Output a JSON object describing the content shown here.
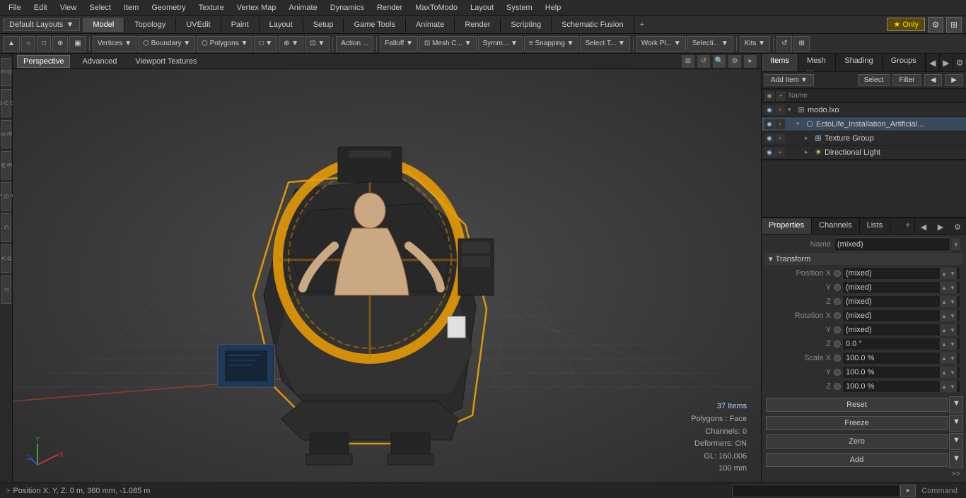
{
  "menu": {
    "items": [
      "File",
      "Edit",
      "View",
      "Select",
      "Item",
      "Geometry",
      "Texture",
      "Vertex Map",
      "Animate",
      "Dynamics",
      "Render",
      "MaxToModo",
      "Layout",
      "System",
      "Help"
    ]
  },
  "layout_bar": {
    "dropdown": "Default Layouts",
    "tabs": [
      "Model",
      "Topology",
      "UVEdit",
      "Paint",
      "Layout",
      "Setup",
      "Game Tools",
      "Animate",
      "Render",
      "Scripting",
      "Schematic Fusion"
    ],
    "active_tab": "Model",
    "add_btn": "+",
    "star_only": "★  Only"
  },
  "toolbar": {
    "buttons": [
      {
        "label": "▲",
        "name": "select-mode-vert"
      },
      {
        "label": "○",
        "name": "select-mode-edge"
      },
      {
        "label": "□",
        "name": "select-mode-poly"
      },
      {
        "label": "⊕",
        "name": "select-mode-item"
      },
      {
        "label": "▣",
        "name": "select-mode-mat"
      },
      {
        "label": "Vertices ▼",
        "name": "vertices-btn"
      },
      {
        "label": "Boundary ▼",
        "name": "boundary-btn"
      },
      {
        "label": "Polygons ▼",
        "name": "polygons-btn"
      },
      {
        "label": "□ ▼",
        "name": "shape-btn"
      },
      {
        "label": "⊕ ▼",
        "name": "visibility-btn"
      },
      {
        "label": "⊡ ▼",
        "name": "render-btn"
      },
      {
        "label": "Action ...",
        "name": "action-btn"
      },
      {
        "label": "Falloff ▼",
        "name": "falloff-btn"
      },
      {
        "label": "Mesh C... ▼",
        "name": "mesh-constraint-btn"
      },
      {
        "label": "Symm... ▼",
        "name": "symmetry-btn"
      },
      {
        "label": "≡ Snapping ▼",
        "name": "snapping-btn"
      },
      {
        "label": "Select T... ▼",
        "name": "select-through-btn"
      },
      {
        "label": "Work Pl... ▼",
        "name": "work-plane-btn"
      },
      {
        "label": "Selecti... ▼",
        "name": "selection-btn"
      },
      {
        "label": "Kits ▼",
        "name": "kits-btn"
      },
      {
        "label": "↺",
        "name": "reset-view-btn"
      },
      {
        "label": "⊞",
        "name": "fullscreen-btn"
      }
    ]
  },
  "viewport": {
    "tabs": [
      "Perspective",
      "Advanced",
      "Viewport Textures"
    ],
    "active_tab": "Perspective",
    "info": {
      "items": "37 Items",
      "polygons": "Polygons : Face",
      "channels": "Channels: 0",
      "deformers": "Deformers: ON",
      "gl": "GL: 160,006",
      "size": "100 mm"
    }
  },
  "items_panel": {
    "tabs": [
      "Items",
      "Mesh ...",
      "Shading",
      "Groups"
    ],
    "active_tab": "Items",
    "toolbar": {
      "add_item": "Add Item",
      "select": "Select",
      "filter": "Filter"
    },
    "list": [
      {
        "name": "modo.lxo",
        "type": "file",
        "indent": 0,
        "expanded": true
      },
      {
        "name": "EctoLife_Installation_Artificial...",
        "type": "mesh",
        "indent": 1,
        "expanded": true
      },
      {
        "name": "Texture Group",
        "type": "folder",
        "indent": 2,
        "expanded": false
      },
      {
        "name": "Directional Light",
        "type": "light",
        "indent": 2,
        "expanded": false
      }
    ]
  },
  "properties_panel": {
    "tabs": [
      "Properties",
      "Channels",
      "Lists"
    ],
    "active_tab": "Properties",
    "name_field": "(mixed)",
    "transform": {
      "label": "Transform",
      "position": {
        "x": "(mixed)",
        "y": "(mixed)",
        "z": "(mixed)"
      },
      "rotation": {
        "x": "(mixed)",
        "y": "(mixed)",
        "z": "0.0 °"
      },
      "scale": {
        "x": "100.0 %",
        "y": "100.0 %",
        "z": "100.0 %"
      }
    },
    "actions": [
      "Reset",
      "Freeze",
      "Zero",
      "Add"
    ]
  },
  "bottom_bar": {
    "status": "Position X, Y, Z:  0 m, 360 mm, -1.085 m",
    "command_label": "Command",
    "prompt_arrow": ">"
  },
  "colors": {
    "active_tab": "#4a7aaa",
    "accent": "#f0a000",
    "bg_dark": "#252525",
    "bg_mid": "#2e2e2e",
    "bg_light": "#3a3a3a"
  }
}
